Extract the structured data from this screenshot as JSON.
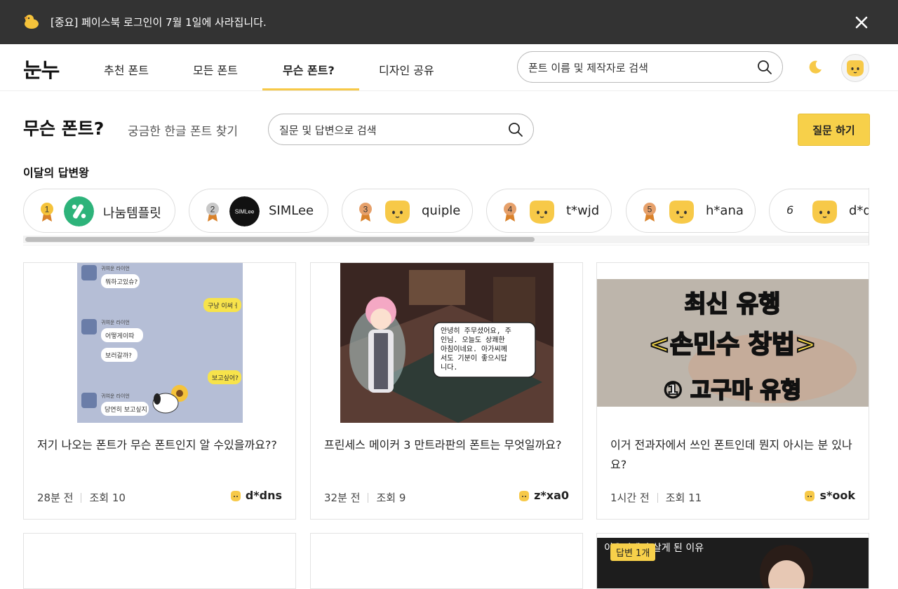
{
  "banner": {
    "text": "[중요] 페이스북 로그인이 7월 1일에 사라집니다.",
    "icon": "duck-icon",
    "close_icon": "close-icon"
  },
  "nav": {
    "logo": "눈누",
    "items": [
      {
        "label": "추천 폰트"
      },
      {
        "label": "모든 폰트"
      },
      {
        "label": "무슨 폰트?",
        "active": true
      },
      {
        "label": "디자인 공유"
      }
    ],
    "search_placeholder": "폰트 이름 및 제작자로 검색"
  },
  "page": {
    "title": "무슨 폰트?",
    "subtitle": "궁금한 한글 폰트 찾기",
    "search_placeholder": "질문 및 답변으로 검색",
    "ask_button": "질문 하기"
  },
  "ranking": {
    "title": "이달의 답변왕",
    "users": [
      {
        "rank": "1",
        "name": "나눔템플릿",
        "medal_color": "#f5c33b"
      },
      {
        "rank": "2",
        "name": "SIMLee",
        "medal_color": "#c8c8c8",
        "avatar_text": "SIMLee"
      },
      {
        "rank": "3",
        "name": "quiple",
        "medal_color": "#e6a06a"
      },
      {
        "rank": "4",
        "name": "t*wjd",
        "medal_color": "#e6a06a"
      },
      {
        "rank": "5",
        "name": "h*ana",
        "medal_color": "#e6a06a"
      },
      {
        "rank": "6",
        "name": "d*dns"
      }
    ]
  },
  "cards": [
    {
      "title": "저기 나오는 폰트가 무슨 폰트인지 알 수있을까요??",
      "time": "28분 전",
      "views": "조회 10",
      "author": "d*dns"
    },
    {
      "title": "프린세스 메이커 3 만트라판의 폰트는 무엇일까요?",
      "time": "32분 전",
      "views": "조회 9",
      "author": "z*xa0",
      "thumb_text": [
        "안녕히 주무셨어요, 주",
        "인님. 오늘도 상쾌한",
        "아침이네요. 아가씨께",
        "서도 기분이 좋으시답",
        "니다."
      ]
    },
    {
      "title": "이거 전과자에서 쓰인 폰트인데 뭔지 아시는 분 있나요?",
      "time": "1시간 전",
      "views": "조회 11",
      "author": "s*ook",
      "thumb_lines": [
        "최신 유행",
        "<손민수 창법>",
        "① 고구마 유형"
      ]
    }
  ],
  "chat_thumb": {
    "name": "귀여운 라이언",
    "bubbles": [
      "뭐하고있슈?",
      "구냥 이써ㅓ",
      "어떻게이따",
      "보러갈까?",
      "보고싶어?",
      "당연히 보고싶지"
    ]
  },
  "bottom_cards": [
    {
      "thumb_caption": "이유지에서 살게 된 이유",
      "badge": "답변 1개"
    }
  ],
  "colors": {
    "accent": "#f7d04a",
    "banner_bg": "#333333",
    "nanum_green": "#2db37a"
  }
}
